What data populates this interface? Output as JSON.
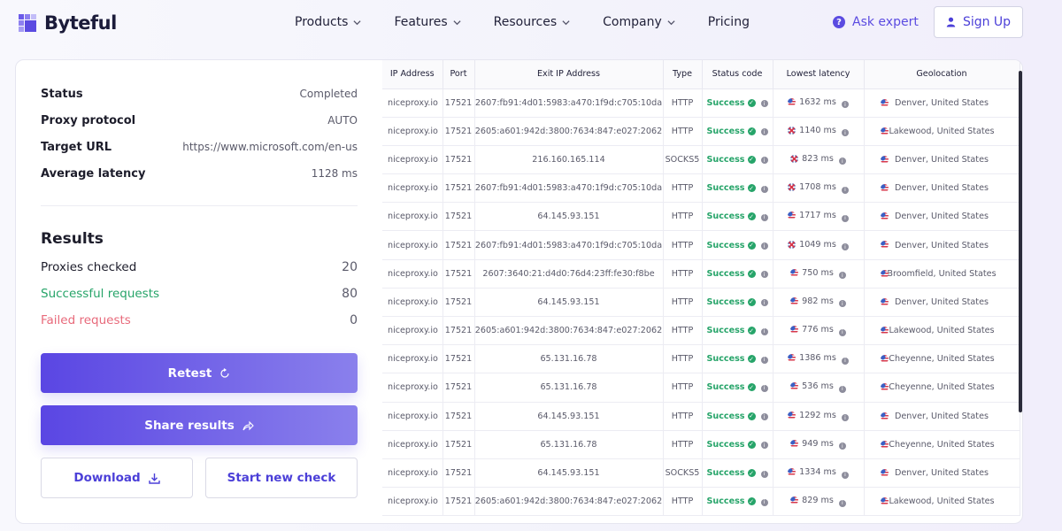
{
  "header": {
    "logo_text": "Byteful",
    "nav": [
      {
        "label": "Products",
        "has_dropdown": true
      },
      {
        "label": "Features",
        "has_dropdown": true
      },
      {
        "label": "Resources",
        "has_dropdown": true
      },
      {
        "label": "Company",
        "has_dropdown": true
      },
      {
        "label": "Pricing",
        "has_dropdown": false
      }
    ],
    "ask_expert_label": "Ask expert",
    "signup_label": "Sign Up"
  },
  "summary": {
    "status_label": "Status",
    "status_value": "Completed",
    "protocol_label": "Proxy protocol",
    "protocol_value": "AUTO",
    "target_label": "Target URL",
    "target_value": "https://www.microsoft.com/en-us",
    "latency_label": "Average latency",
    "latency_value": "1128 ms"
  },
  "results": {
    "title": "Results",
    "checked_label": "Proxies checked",
    "checked_value": "20",
    "success_label": "Successful requests",
    "success_value": "80",
    "failed_label": "Failed requests",
    "failed_value": "0"
  },
  "buttons": {
    "retest": "Retest",
    "share": "Share results",
    "download": "Download",
    "new_check": "Start new check"
  },
  "table": {
    "columns": [
      "IP Address",
      "Port",
      "Exit IP Address",
      "Type",
      "Status code",
      "Lowest latency",
      "Geolocation"
    ],
    "rows": [
      {
        "ip": "niceproxy.io",
        "port": "17521",
        "exit": "2607:fb91:4d01:5983:a470:1f9d:c705:10da",
        "type": "HTTP",
        "status": "Success",
        "latency": "1632 ms",
        "lat_flag": "us",
        "geo": "Denver, United States"
      },
      {
        "ip": "niceproxy.io",
        "port": "17521",
        "exit": "2605:a601:942d:3800:7634:847:e027:2062",
        "type": "HTTP",
        "status": "Success",
        "latency": "1140 ms",
        "lat_flag": "gb",
        "geo": "Lakewood, United States"
      },
      {
        "ip": "niceproxy.io",
        "port": "17521",
        "exit": "216.160.165.114",
        "type": "SOCKS5",
        "status": "Success",
        "latency": "823 ms",
        "lat_flag": "gb",
        "geo": "Denver, United States"
      },
      {
        "ip": "niceproxy.io",
        "port": "17521",
        "exit": "2607:fb91:4d01:5983:a470:1f9d:c705:10da",
        "type": "HTTP",
        "status": "Success",
        "latency": "1708 ms",
        "lat_flag": "gb",
        "geo": "Denver, United States"
      },
      {
        "ip": "niceproxy.io",
        "port": "17521",
        "exit": "64.145.93.151",
        "type": "HTTP",
        "status": "Success",
        "latency": "1717 ms",
        "lat_flag": "us",
        "geo": "Denver, United States"
      },
      {
        "ip": "niceproxy.io",
        "port": "17521",
        "exit": "2607:fb91:4d01:5983:a470:1f9d:c705:10da",
        "type": "HTTP",
        "status": "Success",
        "latency": "1049 ms",
        "lat_flag": "gb",
        "geo": "Denver, United States"
      },
      {
        "ip": "niceproxy.io",
        "port": "17521",
        "exit": "2607:3640:21:d4d0:76d4:23ff:fe30:f8be",
        "type": "HTTP",
        "status": "Success",
        "latency": "750 ms",
        "lat_flag": "us",
        "geo": "Broomfield, United States"
      },
      {
        "ip": "niceproxy.io",
        "port": "17521",
        "exit": "64.145.93.151",
        "type": "HTTP",
        "status": "Success",
        "latency": "982 ms",
        "lat_flag": "us",
        "geo": "Denver, United States"
      },
      {
        "ip": "niceproxy.io",
        "port": "17521",
        "exit": "2605:a601:942d:3800:7634:847:e027:2062",
        "type": "HTTP",
        "status": "Success",
        "latency": "776 ms",
        "lat_flag": "us",
        "geo": "Lakewood, United States"
      },
      {
        "ip": "niceproxy.io",
        "port": "17521",
        "exit": "65.131.16.78",
        "type": "HTTP",
        "status": "Success",
        "latency": "1386 ms",
        "lat_flag": "us",
        "geo": "Cheyenne, United States"
      },
      {
        "ip": "niceproxy.io",
        "port": "17521",
        "exit": "65.131.16.78",
        "type": "HTTP",
        "status": "Success",
        "latency": "536 ms",
        "lat_flag": "us",
        "geo": "Cheyenne, United States"
      },
      {
        "ip": "niceproxy.io",
        "port": "17521",
        "exit": "64.145.93.151",
        "type": "HTTP",
        "status": "Success",
        "latency": "1292 ms",
        "lat_flag": "us",
        "geo": "Denver, United States"
      },
      {
        "ip": "niceproxy.io",
        "port": "17521",
        "exit": "65.131.16.78",
        "type": "HTTP",
        "status": "Success",
        "latency": "949 ms",
        "lat_flag": "us",
        "geo": "Cheyenne, United States"
      },
      {
        "ip": "niceproxy.io",
        "port": "17521",
        "exit": "64.145.93.151",
        "type": "SOCKS5",
        "status": "Success",
        "latency": "1334 ms",
        "lat_flag": "us",
        "geo": "Denver, United States"
      },
      {
        "ip": "niceproxy.io",
        "port": "17521",
        "exit": "2605:a601:942d:3800:7634:847:e027:2062",
        "type": "HTTP",
        "status": "Success",
        "latency": "829 ms",
        "lat_flag": "us",
        "geo": "Lakewood, United States"
      }
    ]
  },
  "colors": {
    "accent": "#5b4be1",
    "success": "#26a469",
    "danger": "#e86a7b"
  }
}
